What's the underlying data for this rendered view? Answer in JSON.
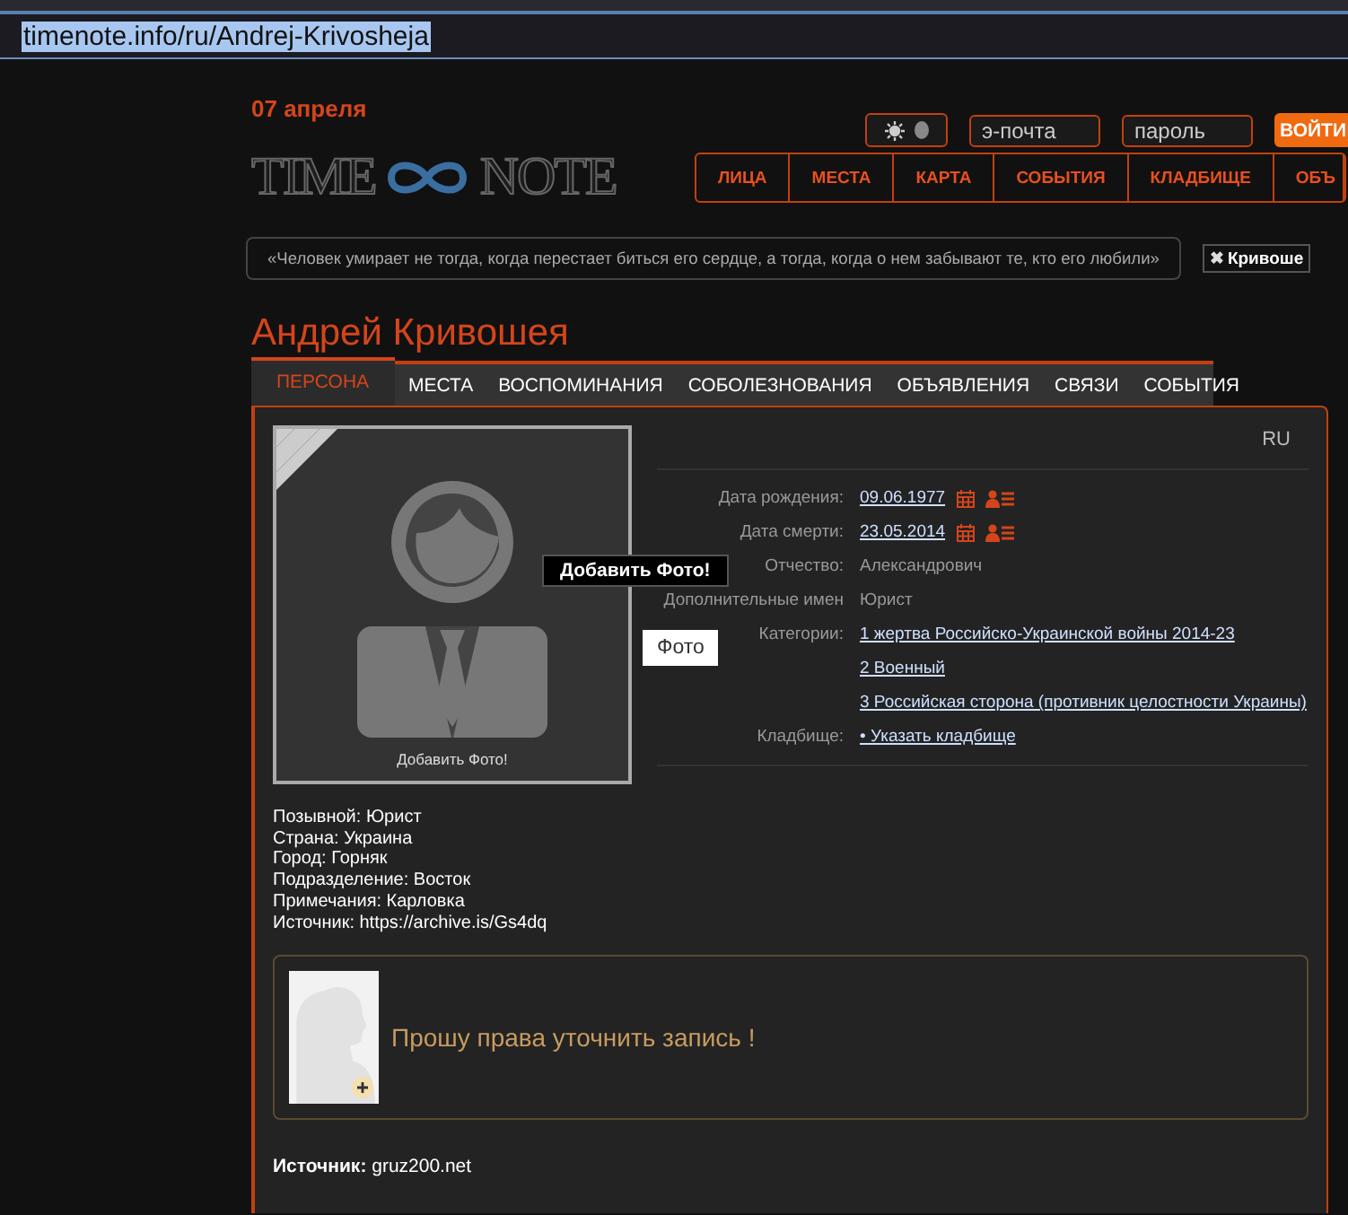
{
  "address_bar": {
    "url": "timenote.info/ru/Andrej-Krivosheja"
  },
  "header": {
    "date": "07 апреля",
    "theme": {
      "dark": true
    },
    "email": {
      "placeholder": "э-почта"
    },
    "password": {
      "placeholder": "пароль"
    },
    "login_button": "ВОЙТИ"
  },
  "logo": {
    "left": "TIME",
    "right": "NOTE"
  },
  "nav": [
    "ЛИЦА",
    "МЕСТА",
    "КАРТА",
    "СОБЫТИЯ",
    "КЛАДБИЩЕ",
    "ОБЪ"
  ],
  "quote": "«Человек умирает не тогда, когда перестает биться его сердце, а тогда, когда о нем забывают те, кто его любили»",
  "tag": {
    "icon": "✖",
    "label": "Кривоше"
  },
  "person": {
    "name": "Андрей Кривошея"
  },
  "tabs": [
    {
      "label": "ПЕРСОНА",
      "selected": true
    },
    {
      "label": "МЕСТА",
      "selected": false
    },
    {
      "label": "ВОСПОМИНАНИЯ",
      "selected": false
    },
    {
      "label": "СОБОЛЕЗНОВАНИЯ",
      "selected": false
    },
    {
      "label": "ОБЪЯВЛЕНИЯ",
      "selected": false
    },
    {
      "label": "СВЯЗИ",
      "selected": false
    },
    {
      "label": "СОБЫТИЯ",
      "selected": false
    }
  ],
  "profile": {
    "language": "RU",
    "photo_caption": "Добавить Фото!",
    "tooltip": "Добавить Фото!",
    "photo_button": "Фото",
    "fields": [
      {
        "kind": "date",
        "label": "Дата рождения:",
        "value": "09.06.1977"
      },
      {
        "kind": "date",
        "label": "Дата смерти:",
        "value": "23.05.2014"
      },
      {
        "kind": "text",
        "label": "Отчество:",
        "value": "Александрович"
      },
      {
        "kind": "text",
        "label": "Дополнительные имен",
        "value": "Юрист"
      },
      {
        "kind": "links",
        "label": "Категории:",
        "links": [
          "1 жертва Российско-Украинской войны 2014-23",
          "2 Военный",
          "3 Российская сторона (противник целостности Украины)"
        ]
      },
      {
        "kind": "link",
        "label": "Кладбище:",
        "value": "• Указать кладбище"
      }
    ]
  },
  "bio": [
    "Позывной: Юрист",
    "Страна: Украина",
    "Город: Горняк",
    "Подразделение: Восток",
    "Примечания: Карловка",
    "Источник: https://archive.is/Gs4dq"
  ],
  "request": {
    "text": "Прошу права уточнить запись !"
  },
  "source": "**Источник:** gruz200.net"
}
